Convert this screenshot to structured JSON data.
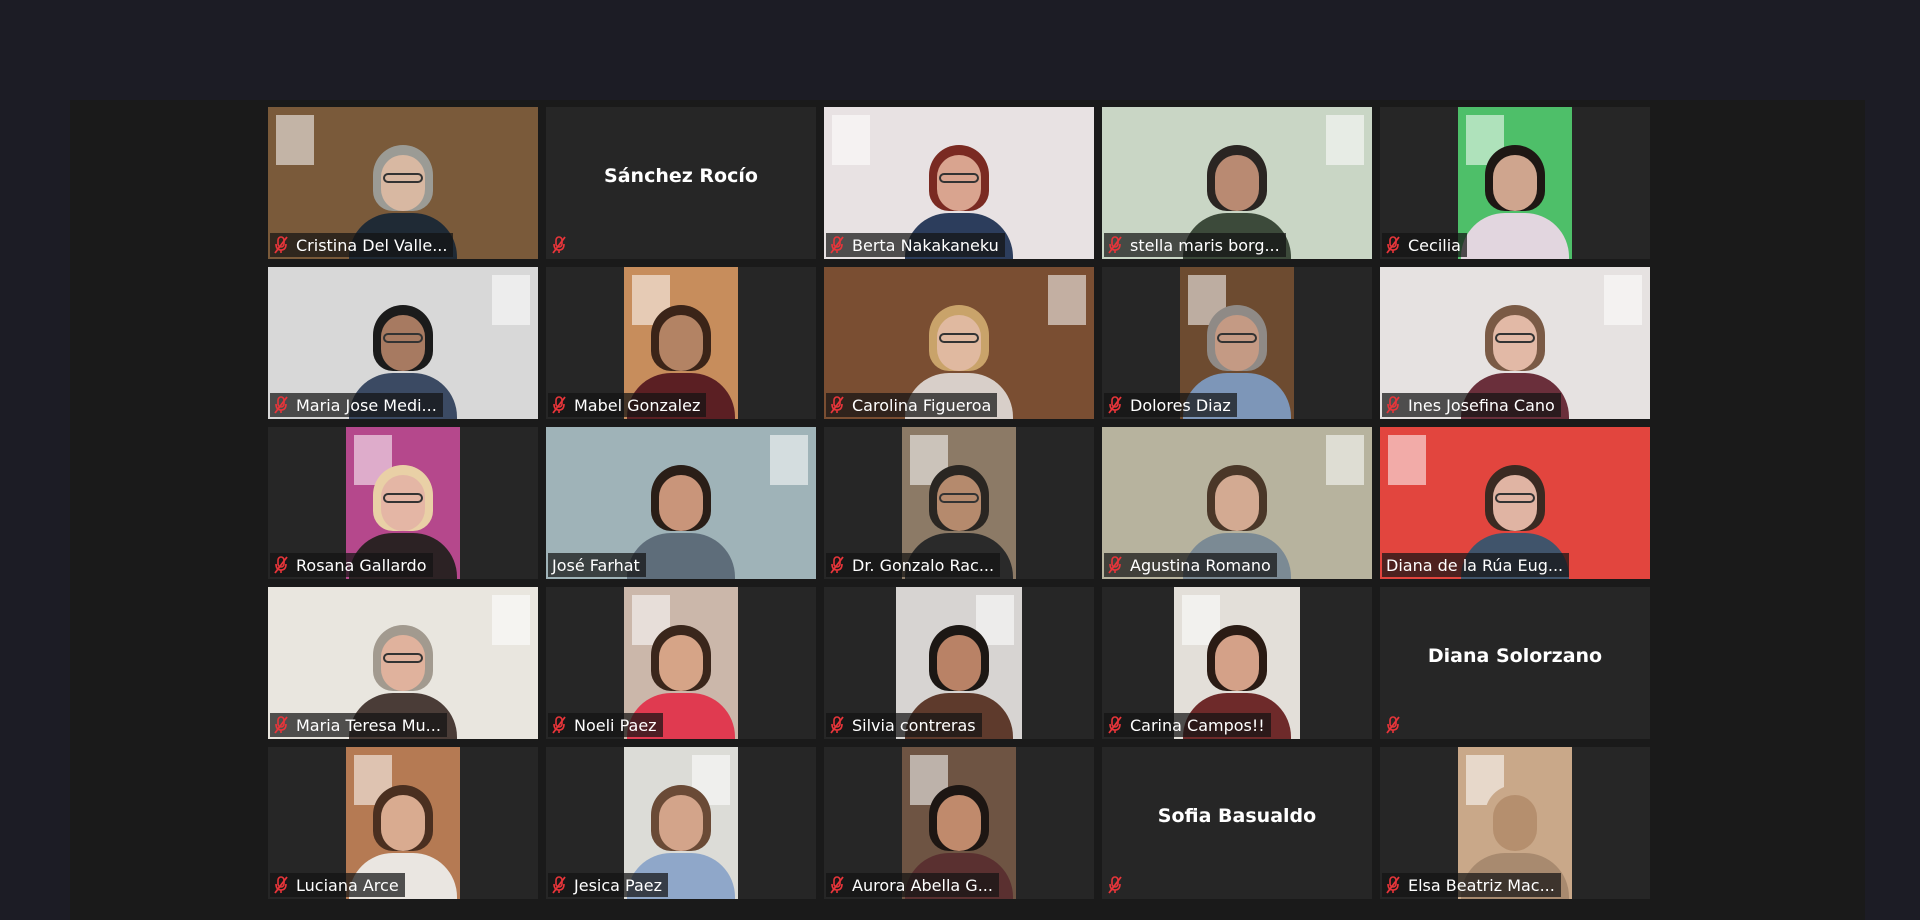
{
  "meeting": {
    "view": "gallery",
    "accent_color": "#c6e84a",
    "muted_icon_color": "#e8353a",
    "tile_background": "#262626"
  },
  "participants": [
    {
      "name": "Cristina Del Valle...",
      "muted": true,
      "video": true,
      "wall": "#7a5a3a",
      "hair": "#9b9b95",
      "skin": "#d8b8a2",
      "shirt": "#1f2a35",
      "glasses": true,
      "layout": "full"
    },
    {
      "name": "Sánchez Rocío",
      "muted": true,
      "video": false
    },
    {
      "name": "Berta Nakakaneku",
      "muted": true,
      "video": true,
      "wall": "#e8e2e3",
      "hair": "#7a2a22",
      "skin": "#d9a48f",
      "shirt": "#2c3d5c",
      "glasses": true,
      "layout": "full"
    },
    {
      "name": "stella maris borg...",
      "muted": true,
      "video": true,
      "wall": "#c9d6c5",
      "hair": "#2a2522",
      "skin": "#b98a72",
      "shirt": "#3c4a3a",
      "glasses": false,
      "layout": "full"
    },
    {
      "name": "Cecilia",
      "muted": true,
      "video": true,
      "wall": "#4ebf69",
      "hair": "#1e1714",
      "skin": "#cfa58e",
      "shirt": "#e2d6df",
      "glasses": false,
      "layout": "narrow"
    },
    {
      "name": "Maria Jose Medi...",
      "muted": true,
      "video": true,
      "wall": "#d8d8d8",
      "hair": "#1b1b1b",
      "skin": "#a77a61",
      "shirt": "#3b4a63",
      "glasses": true,
      "layout": "full"
    },
    {
      "name": "Mabel Gonzalez",
      "muted": true,
      "video": true,
      "wall": "#c78d5c",
      "hair": "#3b2418",
      "skin": "#b38364",
      "shirt": "#5b1f23",
      "glasses": false,
      "layout": "narrow"
    },
    {
      "name": "Carolina Figueroa",
      "muted": true,
      "video": true,
      "wall": "#7a4e32",
      "hair": "#c9a36a",
      "skin": "#e0b9a0",
      "shirt": "#d8cfc9",
      "glasses": true,
      "layout": "full"
    },
    {
      "name": "Dolores Diaz",
      "muted": true,
      "video": true,
      "wall": "#6d4b30",
      "hair": "#8f8a86",
      "skin": "#c49a84",
      "shirt": "#7d96b8",
      "glasses": true,
      "layout": "narrow"
    },
    {
      "name": "Ines Josefina Cano",
      "muted": true,
      "video": true,
      "wall": "#e6e2e1",
      "hair": "#7a5a45",
      "skin": "#e2b9a6",
      "shirt": "#6a2f3b",
      "glasses": true,
      "layout": "full"
    },
    {
      "name": "Rosana Gallardo",
      "muted": true,
      "video": true,
      "wall": "#b5488c",
      "hair": "#e9d0a6",
      "skin": "#e4b6a5",
      "shirt": "#2c2224",
      "glasses": true,
      "layout": "narrow"
    },
    {
      "name": "José Farhat",
      "muted": false,
      "video": true,
      "active_speaker": true,
      "wall": "#9fb3b8",
      "hair": "#2a1e17",
      "skin": "#c9957a",
      "shirt": "#5e6d7a",
      "glasses": false,
      "layout": "full"
    },
    {
      "name": "Dr. Gonzalo Rac...",
      "muted": true,
      "video": true,
      "wall": "#8c7a66",
      "hair": "#2a2622",
      "skin": "#b58a6d",
      "shirt": "#2a2a2a",
      "glasses": true,
      "layout": "narrow"
    },
    {
      "name": "Agustina Romano",
      "muted": true,
      "video": true,
      "wall": "#b7b39e",
      "hair": "#4a3728",
      "skin": "#d3aa92",
      "shirt": "#7b8a94",
      "glasses": false,
      "layout": "full"
    },
    {
      "name": "Diana de la Rúa Eug...",
      "muted": false,
      "video": true,
      "wall": "#e2453e",
      "hair": "#3a2a22",
      "skin": "#e0b4a3",
      "shirt": "#40546b",
      "glasses": true,
      "layout": "full"
    },
    {
      "name": "Maria Teresa Mu...",
      "muted": true,
      "video": true,
      "wall": "#e9e6df",
      "hair": "#a29a8f",
      "skin": "#e0b29d",
      "shirt": "#4a3c37",
      "glasses": true,
      "layout": "full"
    },
    {
      "name": "Noeli Paez",
      "muted": true,
      "video": true,
      "wall": "#cbb7aa",
      "hair": "#3a261b",
      "skin": "#d6a487",
      "shirt": "#e03a50",
      "glasses": false,
      "layout": "narrow"
    },
    {
      "name": "Silvia contreras",
      "muted": true,
      "video": true,
      "wall": "#d7d4d2",
      "hair": "#1c1714",
      "skin": "#b98266",
      "shirt": "#5e3a2c",
      "glasses": false,
      "layout": "narrow-wide"
    },
    {
      "name": "Carina Campos!!",
      "muted": true,
      "video": true,
      "wall": "#e3dfd9",
      "hair": "#2a1b14",
      "skin": "#d4a188",
      "shirt": "#6e2a2a",
      "glasses": false,
      "layout": "narrow-wide"
    },
    {
      "name": "Diana Solorzano",
      "muted": true,
      "video": false
    },
    {
      "name": "Luciana Arce",
      "muted": true,
      "video": true,
      "wall": "#b57a53",
      "hair": "#4a2f20",
      "skin": "#d9ab90",
      "shirt": "#eae6e1",
      "glasses": false,
      "layout": "narrow"
    },
    {
      "name": "Jesica Paez",
      "muted": true,
      "video": true,
      "wall": "#dcdcd7",
      "hair": "#6a4a36",
      "skin": "#d3a48a",
      "shirt": "#8fa7c9",
      "glasses": false,
      "layout": "narrow"
    },
    {
      "name": "Aurora Abella G...",
      "muted": true,
      "video": true,
      "wall": "#6e5443",
      "hair": "#1d1613",
      "skin": "#c08a6c",
      "shirt": "#5a3030",
      "glasses": false,
      "layout": "narrow"
    },
    {
      "name": "Sofia Basualdo",
      "muted": true,
      "video": false
    },
    {
      "name": "Elsa Beatriz Mac...",
      "muted": true,
      "video": true,
      "wall": "#c9a889",
      "hair": "#c9a889",
      "skin": "#b58f6e",
      "shirt": "#a88a6f",
      "glasses": false,
      "layout": "narrow"
    }
  ]
}
